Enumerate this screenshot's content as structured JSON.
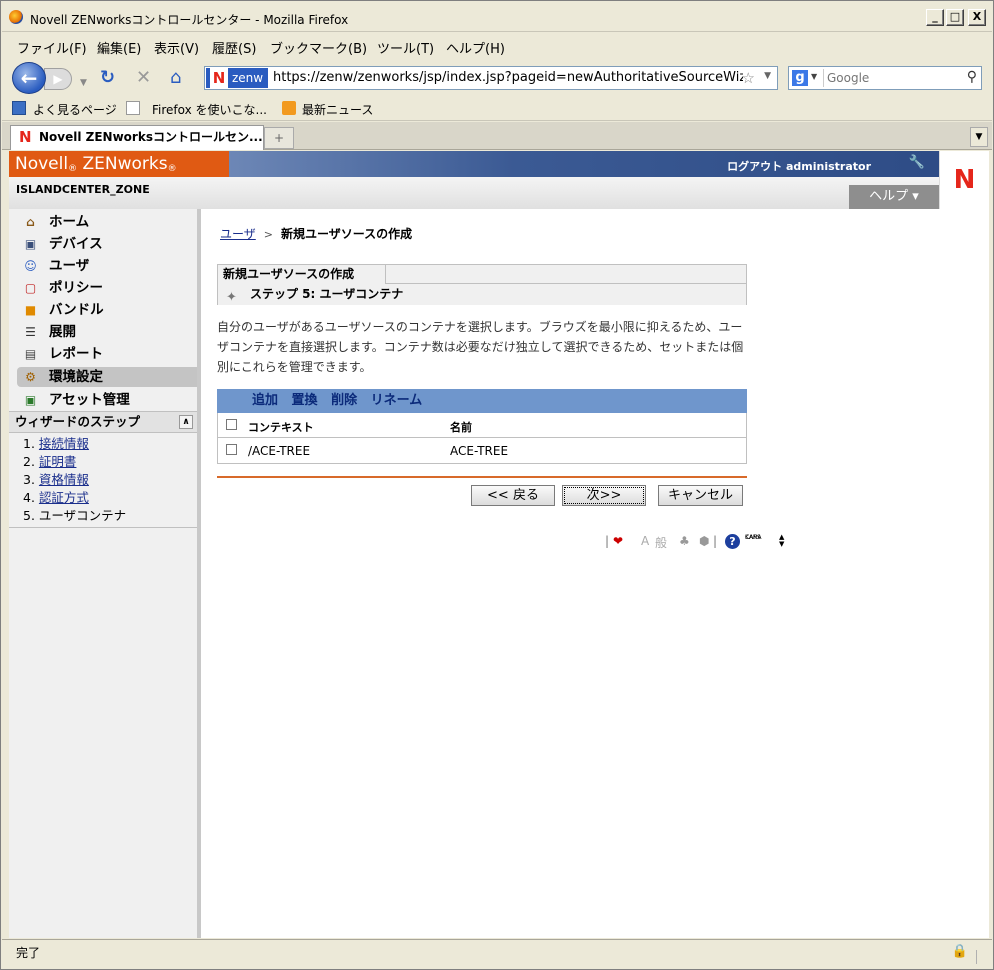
{
  "window": {
    "title": "Novell ZENworksコントロールセンター - Mozilla Firefox",
    "min": "_",
    "max": "□",
    "close": "X"
  },
  "menu": [
    "ファイル(F)",
    "編集(E)",
    "表示(V)",
    "履歴(S)",
    "ブックマーク(B)",
    "ツール(T)",
    "ヘルプ(H)"
  ],
  "nav": {
    "site_label": "zenw",
    "url": "https://zenw/zenworks/jsp/index.jsp?pageid=newAuthoritativeSourceWizard&_",
    "search_placeholder": "Google"
  },
  "bookmarks": [
    "よく見るページ",
    "Firefox を使いこな...",
    "最新ニュース"
  ],
  "tab": {
    "label": "Novell ZENworksコントロールセン...",
    "new_tab": "+"
  },
  "header": {
    "brand": "Novell",
    "brand_product": "ZENworks",
    "reg": "®",
    "logout": "ログアウト administrator",
    "zone": "ISLANDCENTER_ZONE",
    "help": "ヘルプ ▾",
    "logo": "N"
  },
  "sidebar": {
    "items": [
      {
        "label": "ホーム",
        "icon": "home-icon"
      },
      {
        "label": "デバイス",
        "icon": "monitor-icon"
      },
      {
        "label": "ユーザ",
        "icon": "user-icon"
      },
      {
        "label": "ポリシー",
        "icon": "policy-icon"
      },
      {
        "label": "バンドル",
        "icon": "bundle-icon"
      },
      {
        "label": "展開",
        "icon": "deploy-icon"
      },
      {
        "label": "レポート",
        "icon": "report-icon"
      },
      {
        "label": "環境設定",
        "icon": "gear-icon"
      },
      {
        "label": "アセット管理",
        "icon": "asset-icon"
      }
    ],
    "active_index": 7,
    "wizard_title": "ウィザードのステップ",
    "steps": [
      {
        "num": "1.",
        "label": "接続情報",
        "link": true
      },
      {
        "num": "2.",
        "label": "証明書",
        "link": true
      },
      {
        "num": "3.",
        "label": "資格情報",
        "link": true
      },
      {
        "num": "4.",
        "label": "認証方式",
        "link": true
      },
      {
        "num": "5.",
        "label": "ユーザコンテナ",
        "link": false
      }
    ]
  },
  "main": {
    "breadcrumb_link": "ユーザ",
    "breadcrumb_sep": ">",
    "breadcrumb_current": "新規ユーザソースの作成",
    "panel_title": "新規ユーザソースの作成",
    "step_title": "ステップ 5: ユーザコンテナ",
    "description": "自分のユーザがあるユーザソースのコンテナを選択します。ブラウズを最小限に抑えるため、ユーザコンテナを直接選択します。コンテナ数は必要なだけ独立して選択できるため、セットまたは個別にこれらを管理できます。",
    "table": {
      "actions": [
        "追加",
        "置換",
        "削除",
        "リネーム"
      ],
      "headers": [
        "コンテキスト",
        "名前"
      ],
      "rows": [
        {
          "context": "/ACE-TREE",
          "name": "ACE-TREE"
        }
      ]
    },
    "buttons": {
      "back": "<< 戻る",
      "next": "次>>",
      "cancel": "キャンセル"
    },
    "ime": {
      "a": "A",
      "kanji": "般",
      "caps": "CAPS",
      "kana": "KANA"
    }
  },
  "status": {
    "text": "完了"
  }
}
